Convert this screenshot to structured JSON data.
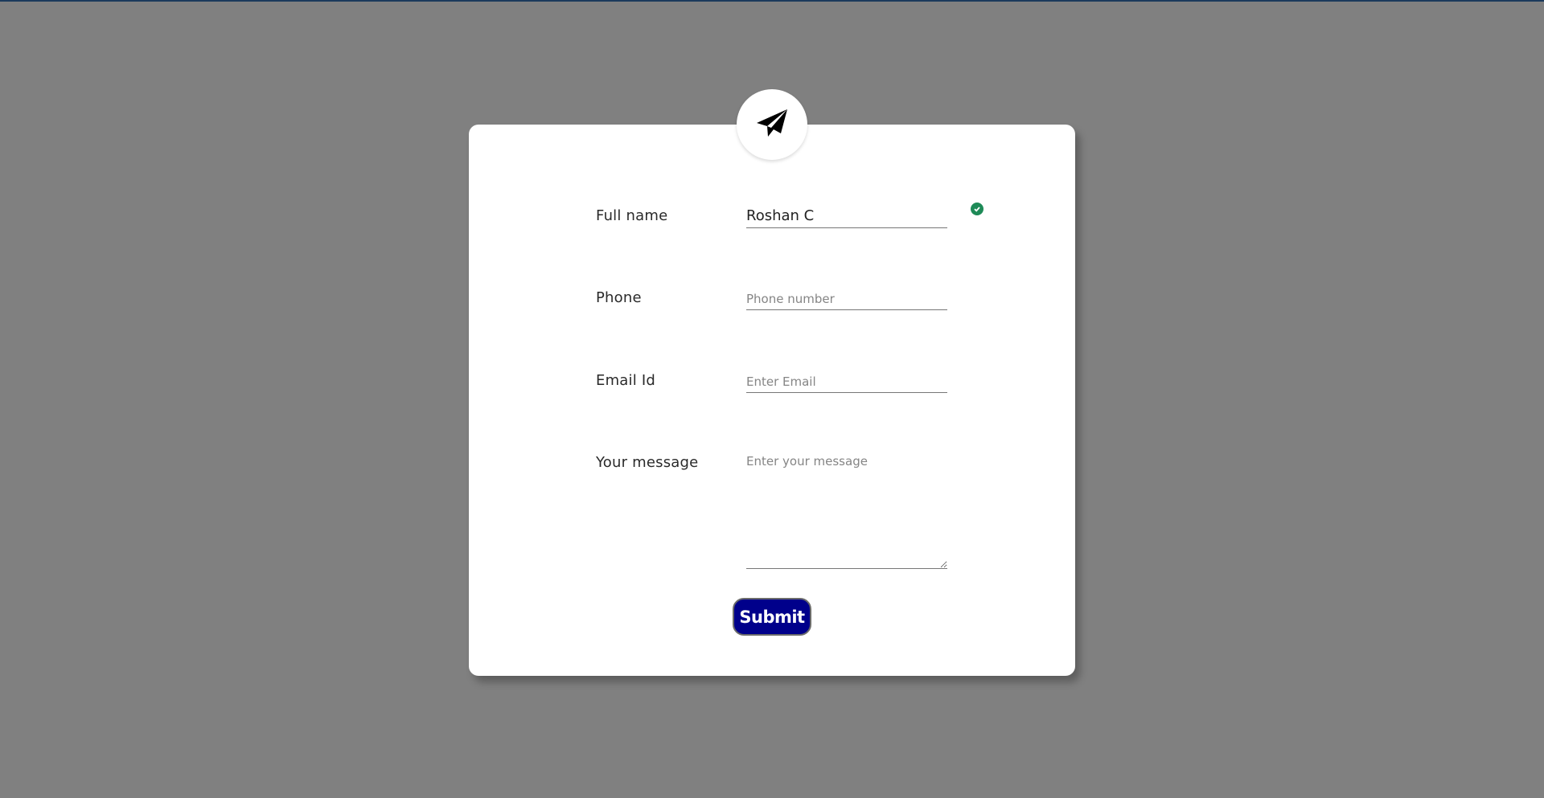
{
  "form": {
    "fields": [
      {
        "label": "Full name",
        "value": "Roshan C",
        "placeholder": "",
        "valid": true
      },
      {
        "label": "Phone",
        "value": "",
        "placeholder": "Phone number"
      },
      {
        "label": "Email Id",
        "value": "",
        "placeholder": "Enter Email"
      },
      {
        "label": "Your message",
        "value": "",
        "placeholder": "Enter your message"
      }
    ],
    "submit_label": "Submit"
  },
  "icons": {
    "logo": "paper-plane-icon",
    "valid": "check-circle-icon"
  },
  "colors": {
    "background": "#808080",
    "card": "#ffffff",
    "submit": "#00008b",
    "valid": "#1e8a57"
  }
}
